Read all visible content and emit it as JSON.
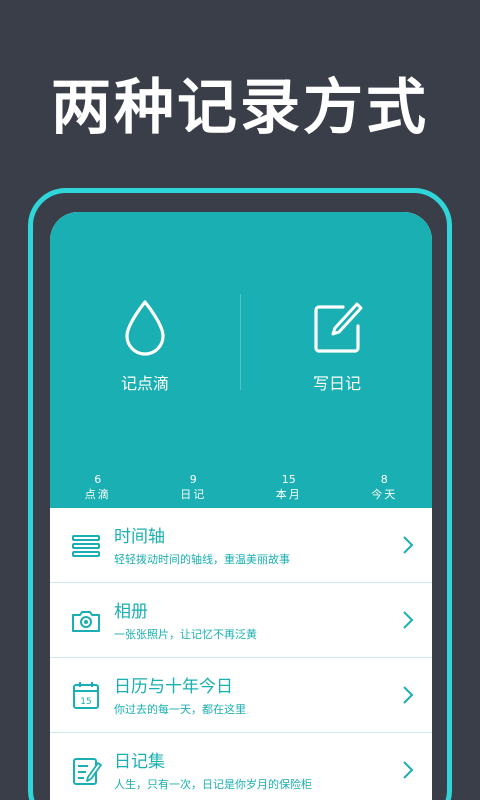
{
  "headline": "两种记录方式",
  "actions": [
    {
      "label": "记点滴",
      "icon": "drop-icon"
    },
    {
      "label": "写日记",
      "icon": "edit-note-icon"
    }
  ],
  "stats": [
    {
      "value": "6",
      "label": "点滴"
    },
    {
      "value": "9",
      "label": "日记"
    },
    {
      "value": "15",
      "label": "本月"
    },
    {
      "value": "8",
      "label": "今天"
    }
  ],
  "list": [
    {
      "title": "时间轴",
      "subtitle": "轻轻拨动时间的轴线，重温美丽故事",
      "icon": "timeline-icon"
    },
    {
      "title": "相册",
      "subtitle": "一张张照片，让记忆不再泛黄",
      "icon": "camera-icon"
    },
    {
      "title": "日历与十年今日",
      "subtitle": "你过去的每一天，都在这里",
      "icon": "calendar-icon"
    },
    {
      "title": "日记集",
      "subtitle": "人生，只有一次，日记是你岁月的保险柜",
      "icon": "diary-icon"
    }
  ],
  "colors": {
    "accent": "#1aafb2",
    "frame": "#2fd6d9",
    "background": "#3a3e48"
  }
}
